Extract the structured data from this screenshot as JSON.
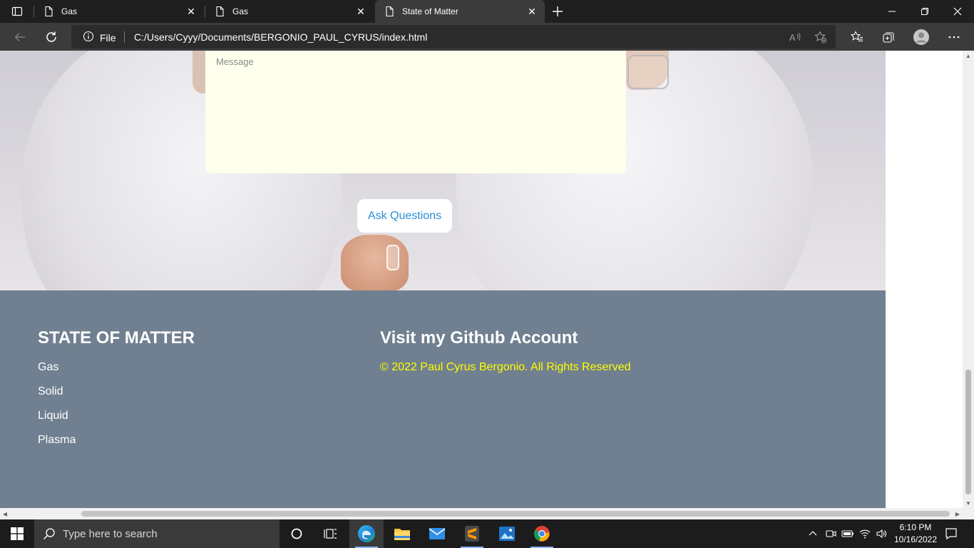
{
  "browser": {
    "tabs": [
      {
        "title": "Gas",
        "active": false
      },
      {
        "title": "Gas",
        "active": false
      },
      {
        "title": "State of Matter",
        "active": true
      }
    ],
    "address": {
      "scheme_label": "File",
      "url": "C:/Users/Cyyy/Documents/BERGONIO_PAUL_CYRUS/index.html"
    }
  },
  "page": {
    "message_placeholder": "Message",
    "ask_button": "Ask Questions",
    "footer": {
      "brand_title": "STATE OF MATTER",
      "links": [
        "Gas",
        "Solid",
        "Liquid",
        "Plasma"
      ],
      "github_title": "Visit my Github Account",
      "copyright": "© 2022 Paul Cyrus Bergonio. All Rights Reserved"
    },
    "colors": {
      "footer_bg": "#708090",
      "copyright_text": "#ffff00",
      "message_bg": "#ffffee",
      "button_text": "#2a8fd6"
    }
  },
  "taskbar": {
    "search_placeholder": "Type here to search",
    "time": "6:10 PM",
    "date": "10/16/2022"
  }
}
